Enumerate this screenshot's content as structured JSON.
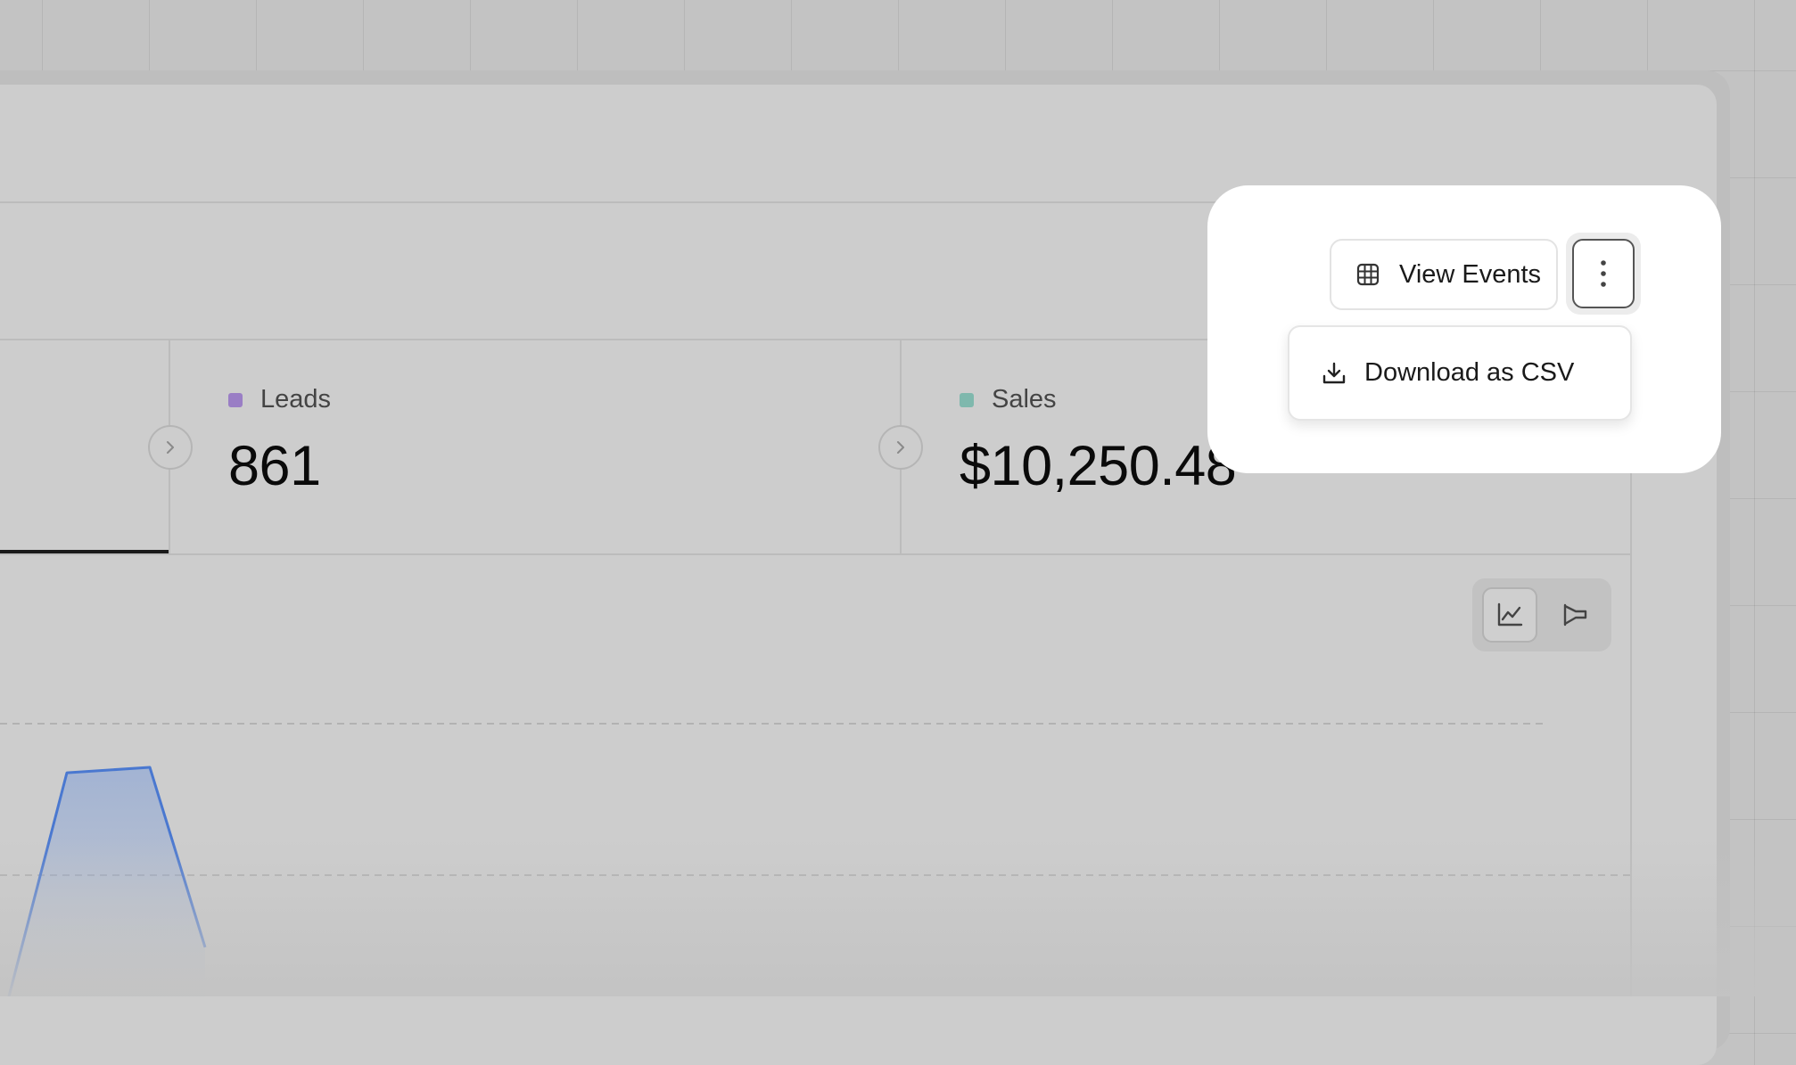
{
  "toolbar": {
    "view_events_label": "View Events",
    "view_events_icon": "table-grid-icon",
    "more_icon": "vertical-ellipsis-icon"
  },
  "dropdown": {
    "items": [
      {
        "label": "Download as CSV",
        "icon": "download-icon"
      }
    ]
  },
  "metrics": [
    {
      "label": "Leads",
      "value": "861",
      "color": "#9a7ec5"
    },
    {
      "label": "Sales",
      "value": "$10,250.48",
      "color": "#7fb8ad"
    }
  ],
  "chart_toggle": {
    "options": [
      {
        "icon": "line-chart-icon",
        "active": true
      },
      {
        "icon": "funnel-chart-icon",
        "active": false
      }
    ]
  },
  "chart_data": {
    "type": "area",
    "series": [
      {
        "color": "#4a78d0",
        "values": [
          0,
          0.82,
          0.84,
          0.18
        ]
      }
    ]
  },
  "colors": {
    "accent": "#4a78d0",
    "leads": "#9a7ec5",
    "sales": "#7fb8ad"
  }
}
